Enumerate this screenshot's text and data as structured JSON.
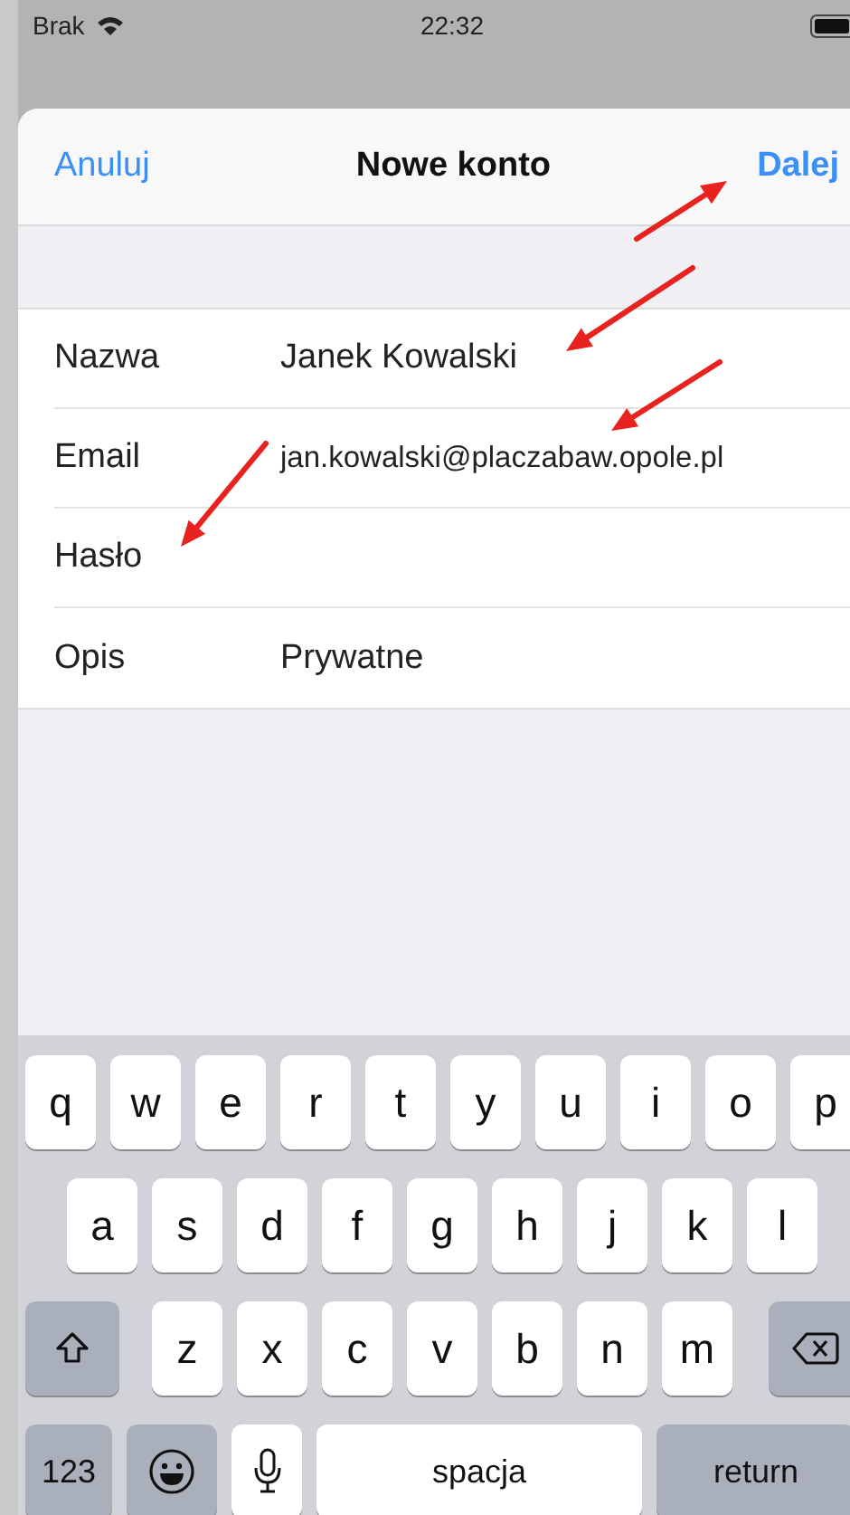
{
  "status_bar": {
    "carrier": "Brak",
    "time": "22:32"
  },
  "header": {
    "cancel": "Anuluj",
    "title": "Nowe konto",
    "next": "Dalej"
  },
  "form": {
    "rows": [
      {
        "label": "Nazwa",
        "value": "Janek Kowalski"
      },
      {
        "label": "Email",
        "value": "jan.kowalski@placzabaw.opole.pl"
      },
      {
        "label": "Hasło"
      },
      {
        "label": "Opis",
        "value": "Prywatne"
      }
    ]
  },
  "keyboard": {
    "letter_rows": [
      [
        "q",
        "w",
        "e",
        "r",
        "t",
        "y",
        "u",
        "i",
        "o",
        "p"
      ],
      [
        "a",
        "s",
        "d",
        "f",
        "g",
        "h",
        "j",
        "k",
        "l"
      ],
      [
        "z",
        "x",
        "c",
        "v",
        "b",
        "n",
        "m"
      ]
    ],
    "numbers_key": "123",
    "space_key": "spacja",
    "return_key": "return"
  }
}
